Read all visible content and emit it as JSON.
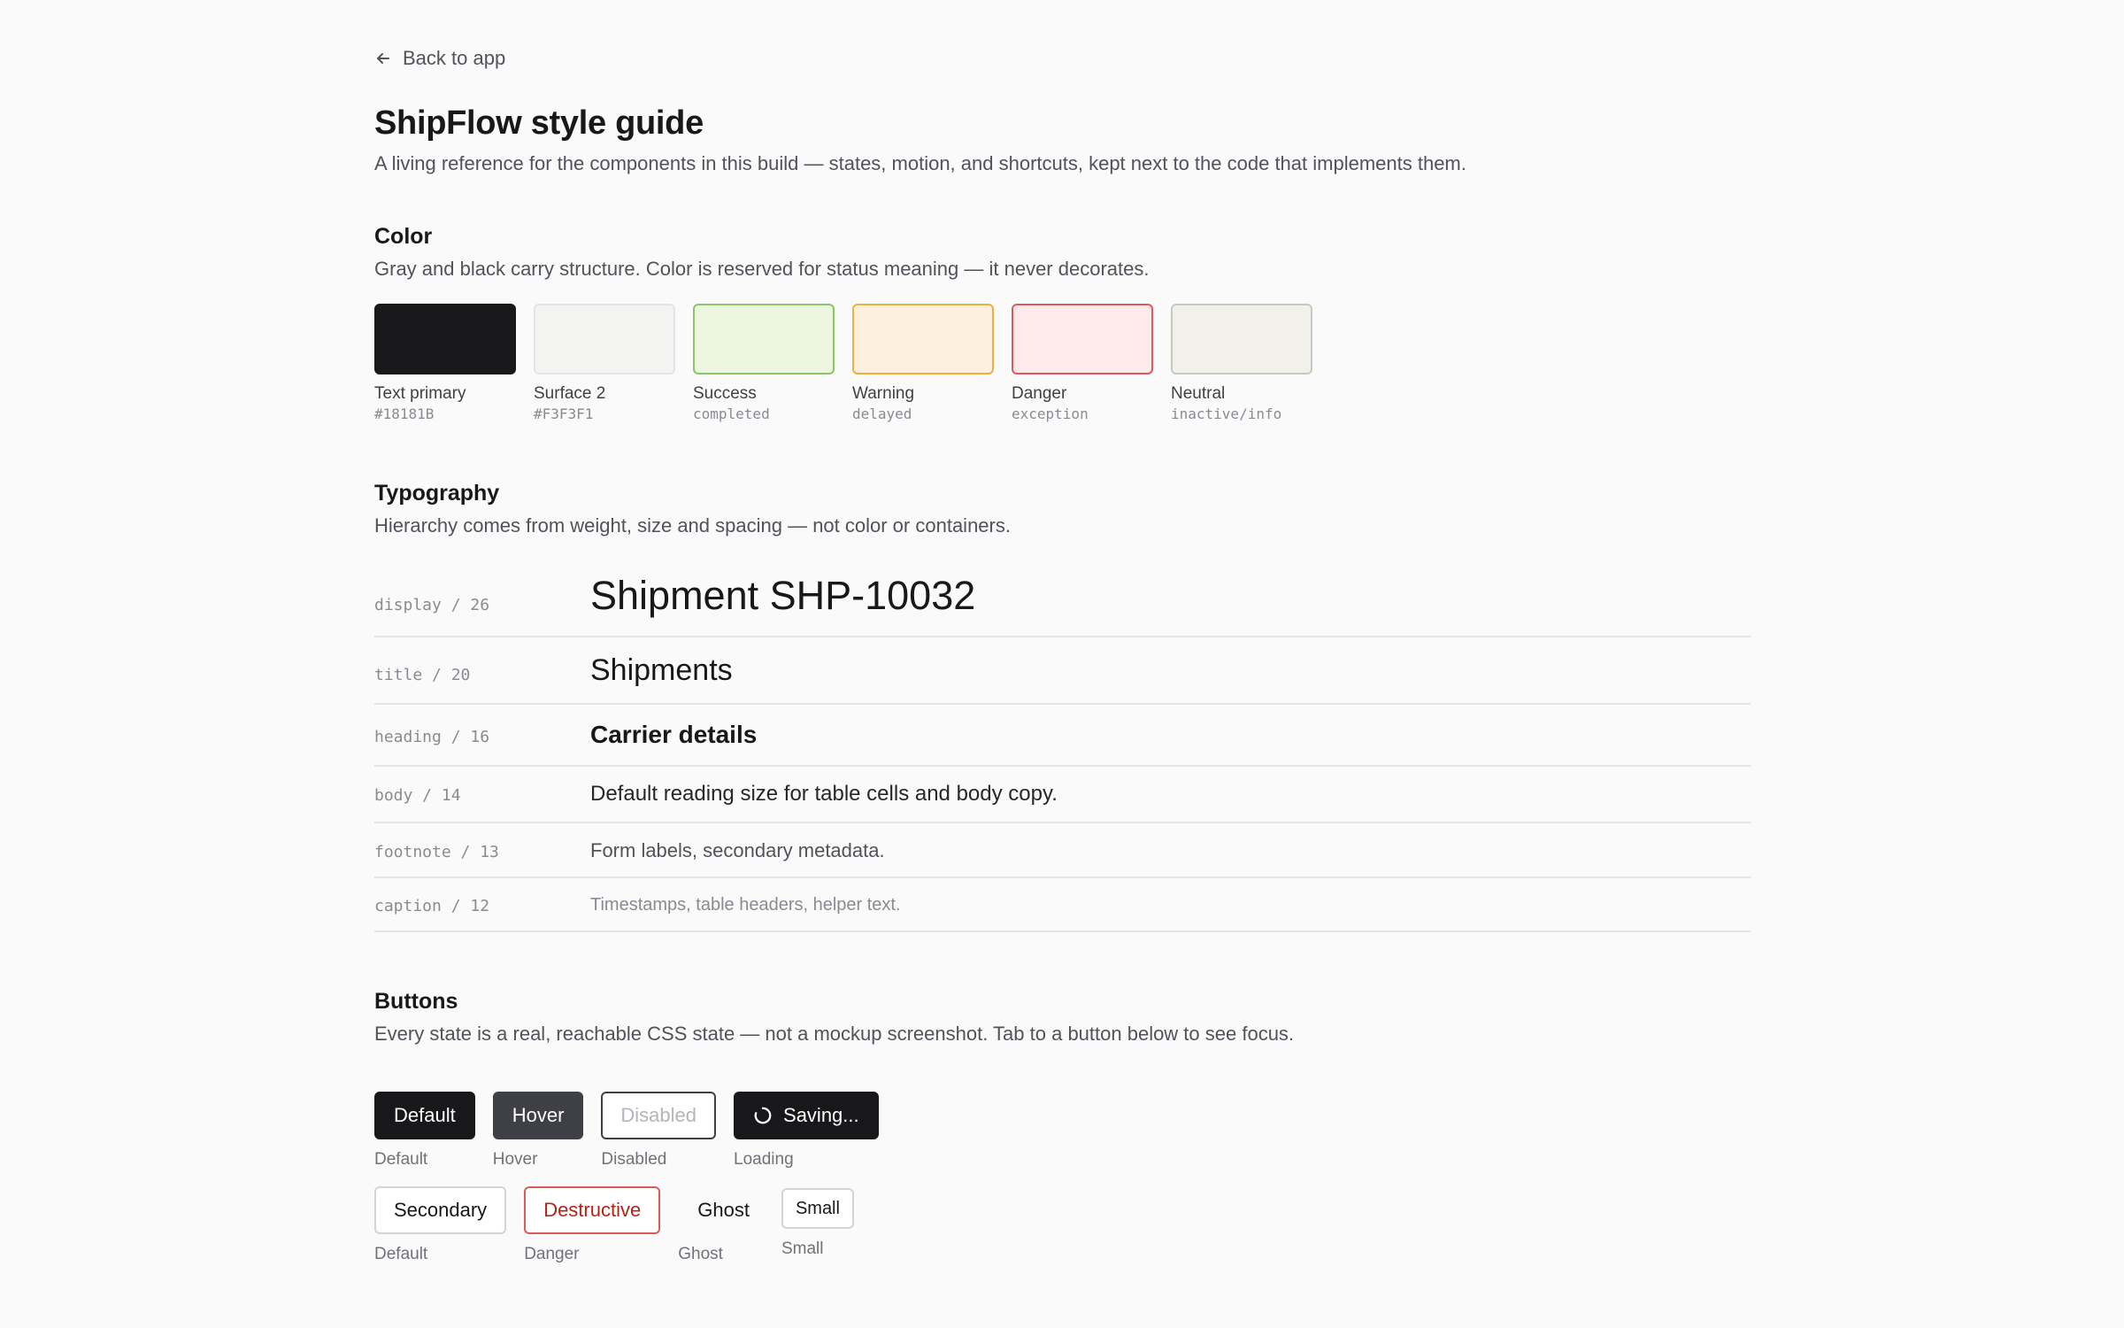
{
  "nav": {
    "back_label": "Back to app",
    "back_icon": "arrow-left-icon"
  },
  "header": {
    "title": "ShipFlow style guide",
    "subtitle": "A living reference for the components in this build — states, motion, and shortcuts, kept next to the code that implements them."
  },
  "color": {
    "title": "Color",
    "description": "Gray and black carry structure. Color is reserved for status meaning — it never decorates.",
    "swatches": [
      {
        "name": "Text primary",
        "code": "#18181B",
        "fill": "#18181b",
        "border": "#18181b"
      },
      {
        "name": "Surface 2",
        "code": "#F3F3F1",
        "fill": "#f3f3f1",
        "border": "#e4e4e2"
      },
      {
        "name": "Success",
        "code": "completed",
        "fill": "#ecf5df",
        "border": "#8bc46a"
      },
      {
        "name": "Warning",
        "code": "delayed",
        "fill": "#fdf0dc",
        "border": "#e8b046"
      },
      {
        "name": "Danger",
        "code": "exception",
        "fill": "#fdebeb",
        "border": "#dc5a5a"
      },
      {
        "name": "Neutral",
        "code": "inactive/info",
        "fill": "#f1f0eb",
        "border": "#c8c8c0"
      }
    ]
  },
  "typography": {
    "title": "Typography",
    "description": "Hierarchy comes from weight, size and spacing — not color or containers.",
    "rows": [
      {
        "token": "display / 26",
        "sample": "Shipment SHP-10032"
      },
      {
        "token": "title / 20",
        "sample": "Shipments"
      },
      {
        "token": "heading / 16",
        "sample": "Carrier details"
      },
      {
        "token": "body / 14",
        "sample": "Default reading size for table cells and body copy."
      },
      {
        "token": "footnote / 13",
        "sample": "Form labels, secondary metadata."
      },
      {
        "token": "caption / 12",
        "sample": "Timestamps, table headers, helper text."
      }
    ]
  },
  "buttons": {
    "title": "Buttons",
    "description": "Every state is a real, reachable CSS state — not a mockup screenshot. Tab to a button below to see focus.",
    "primary_row": [
      {
        "label": "Default",
        "caption": "Default"
      },
      {
        "label": "Hover",
        "caption": "Hover"
      },
      {
        "label": "Disabled",
        "caption": "Disabled"
      },
      {
        "label": "Saving...",
        "caption": "Loading"
      }
    ],
    "secondary_row": [
      {
        "label": "Secondary",
        "caption": "Default"
      },
      {
        "label": "Destructive",
        "caption": "Danger"
      },
      {
        "label": "Ghost",
        "caption": "Ghost"
      },
      {
        "label": "Small",
        "caption": "Small"
      }
    ]
  }
}
